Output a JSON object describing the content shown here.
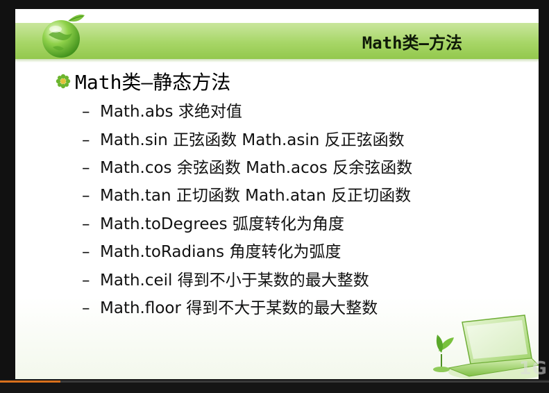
{
  "slide": {
    "title": "Math类—方法",
    "heading": "Math类—静态方法",
    "items": [
      {
        "bullet": "–",
        "text": "Math.abs 求绝对值"
      },
      {
        "bullet": "–",
        "text": "Math.sin 正弦函数 Math.asin 反正弦函数"
      },
      {
        "bullet": "–",
        "text": "Math.cos 余弦函数 Math.acos 反余弦函数"
      },
      {
        "bullet": "–",
        "text": "Math.tan 正切函数 Math.atan 反正切函数"
      },
      {
        "bullet": "–",
        "text": "Math.toDegrees 弧度转化为角度"
      },
      {
        "bullet": "–",
        "text": "Math.toRadians 角度转化为弧度"
      },
      {
        "bullet": "–",
        "text": "Math.ceil 得到不小于某数的最大整数"
      },
      {
        "bullet": "–",
        "text": "Math.floor 得到不大于某数的最大整数"
      }
    ]
  },
  "icons": {
    "logo": "globe-leaf-icon",
    "bullet": "green-flower-bullet-icon",
    "corner": "laptop-plant-decoration"
  },
  "player": {
    "watermark": "1G",
    "progress": 0.11
  },
  "colors": {
    "title_band": "#a7d667",
    "progress": "#d8701c",
    "text": "#111111"
  }
}
